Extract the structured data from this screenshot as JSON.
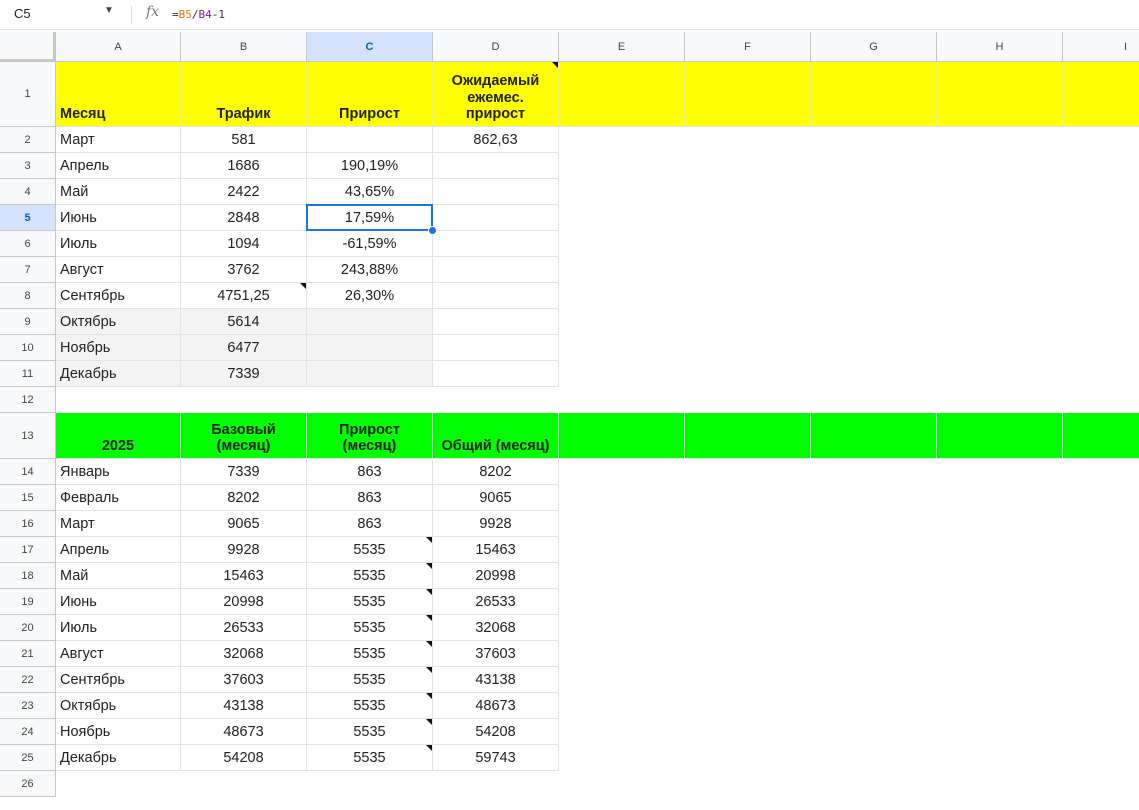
{
  "formula_bar": {
    "name_box": "C5",
    "fx_icon": "fx-icon",
    "formula": {
      "eq": "=",
      "ref1": "B5",
      "slash": "/",
      "ref2": "B4",
      "rest": "-1"
    }
  },
  "columns": [
    "A",
    "B",
    "C",
    "D",
    "E",
    "F",
    "G",
    "H",
    "I"
  ],
  "rows": [
    "1",
    "2",
    "3",
    "4",
    "5",
    "6",
    "7",
    "8",
    "9",
    "10",
    "11",
    "12",
    "13",
    "14",
    "15",
    "16",
    "17",
    "18",
    "19",
    "20",
    "21",
    "22",
    "23",
    "24",
    "25",
    "26"
  ],
  "selected": {
    "cell": "C5",
    "column": "C",
    "row": "5"
  },
  "colors": {
    "header_yellow": "#ffff00",
    "header_green": "#00ff00",
    "gray_fill": "#f3f3f3",
    "selection": "#1a73e8"
  },
  "table1": {
    "headers": {
      "month": "Месяц",
      "traffic": "Трафик",
      "growth": "Прирост",
      "expected": "Ожидаемый ежемес. прирост"
    },
    "rows": [
      {
        "month": "Март",
        "traffic": "581",
        "growth": "",
        "expected": "862,63"
      },
      {
        "month": "Апрель",
        "traffic": "1686",
        "growth": "190,19%",
        "expected": ""
      },
      {
        "month": "Май",
        "traffic": "2422",
        "growth": "43,65%",
        "expected": ""
      },
      {
        "month": "Июнь",
        "traffic": "2848",
        "growth": "17,59%",
        "expected": ""
      },
      {
        "month": "Июль",
        "traffic": "1094",
        "growth": "-61,59%",
        "expected": ""
      },
      {
        "month": "Август",
        "traffic": "3762",
        "growth": "243,88%",
        "expected": ""
      },
      {
        "month": "Сентябрь",
        "traffic": "4751,25",
        "growth": "26,30%",
        "expected": ""
      },
      {
        "month": "Октябрь",
        "traffic": "5614",
        "growth": "",
        "expected": ""
      },
      {
        "month": "Ноябрь",
        "traffic": "6477",
        "growth": "",
        "expected": ""
      },
      {
        "month": "Декабрь",
        "traffic": "7339",
        "growth": "",
        "expected": ""
      }
    ]
  },
  "table2": {
    "headers": {
      "year": "2025",
      "base": "Базовый (месяц)",
      "growth": "Прирост (месяц)",
      "total": "Общий (месяц)"
    },
    "rows": [
      {
        "month": "Январь",
        "base": "7339",
        "growth": "863",
        "total": "8202"
      },
      {
        "month": "Февраль",
        "base": "8202",
        "growth": "863",
        "total": "9065"
      },
      {
        "month": "Март",
        "base": "9065",
        "growth": "863",
        "total": "9928"
      },
      {
        "month": "Апрель",
        "base": "9928",
        "growth": "5535",
        "total": "15463"
      },
      {
        "month": "Май",
        "base": "15463",
        "growth": "5535",
        "total": "20998"
      },
      {
        "month": "Июнь",
        "base": "20998",
        "growth": "5535",
        "total": "26533"
      },
      {
        "month": "Июль",
        "base": "26533",
        "growth": "5535",
        "total": "32068"
      },
      {
        "month": "Август",
        "base": "32068",
        "growth": "5535",
        "total": "37603"
      },
      {
        "month": "Сентябрь",
        "base": "37603",
        "growth": "5535",
        "total": "43138"
      },
      {
        "month": "Октябрь",
        "base": "43138",
        "growth": "5535",
        "total": "48673"
      },
      {
        "month": "Ноябрь",
        "base": "48673",
        "growth": "5535",
        "total": "54208"
      },
      {
        "month": "Декабрь",
        "base": "54208",
        "growth": "5535",
        "total": "59743"
      }
    ]
  }
}
